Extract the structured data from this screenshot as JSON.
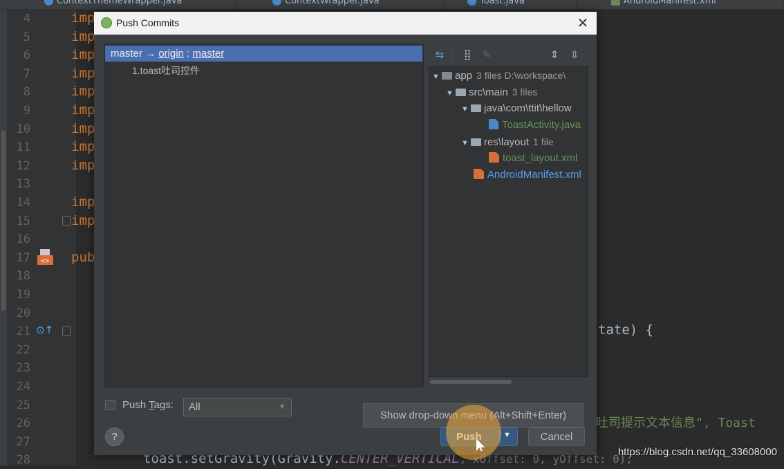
{
  "editor": {
    "tabs": [
      "ContextThemeWrapper.java",
      "ContextWrapper.java",
      "Toast.java",
      "AndroidManifest.xml"
    ],
    "line_numbers": [
      "4",
      "5",
      "6",
      "7",
      "8",
      "9",
      "10",
      "11",
      "12",
      "13",
      "14",
      "15",
      "16",
      "17",
      "18",
      "19",
      "20",
      "21",
      "22",
      "23",
      "24",
      "25",
      "26",
      "27",
      "28"
    ],
    "code_fragments": {
      "imp": "imp",
      "pub": "pub",
      "state_brace": "tate) {",
      "toast_text": "吐司提示文本信息\", Toast",
      "last_line_code": "toast.setGravity(Gravity.",
      "last_line_const": "CENTER_VERTICAL",
      "last_line_params": ", xOffset: 0, yOffset: 0);"
    }
  },
  "dialog": {
    "title": "Push Commits",
    "branch": {
      "local": "master",
      "arrow": " → ",
      "remote": "origin",
      "sep": " : ",
      "remote_branch": "master"
    },
    "commits": [
      "1.toast吐司控件"
    ],
    "files_tree": [
      {
        "name": "app",
        "meta": "3 files  D:\\workspace\\",
        "level": 0,
        "type": "folder"
      },
      {
        "name": "src\\main",
        "meta": "3 files",
        "level": 1,
        "type": "folder"
      },
      {
        "name": "java\\com\\ttit\\hellow",
        "meta": "",
        "level": 2,
        "type": "folder"
      },
      {
        "name": "ToastActivity.java",
        "meta": "",
        "level": 3,
        "type": "java"
      },
      {
        "name": "res\\layout",
        "meta": "1 file",
        "level": 2,
        "type": "folder"
      },
      {
        "name": "toast_layout.xml",
        "meta": "",
        "level": 3,
        "type": "xml"
      },
      {
        "name": "AndroidManifest.xml",
        "meta": "",
        "level": 2,
        "type": "manifest"
      }
    ],
    "push_tags_label_pre": "Push ",
    "push_tags_label_u": "T",
    "push_tags_label_post": "ags:",
    "tags_select_value": "All",
    "tooltip": "Show drop-down menu (Alt+Shift+Enter)",
    "help": "?",
    "push_label": "Push",
    "cancel_label": "Cancel"
  },
  "watermark": "https://blog.csdn.net/qq_33608000"
}
